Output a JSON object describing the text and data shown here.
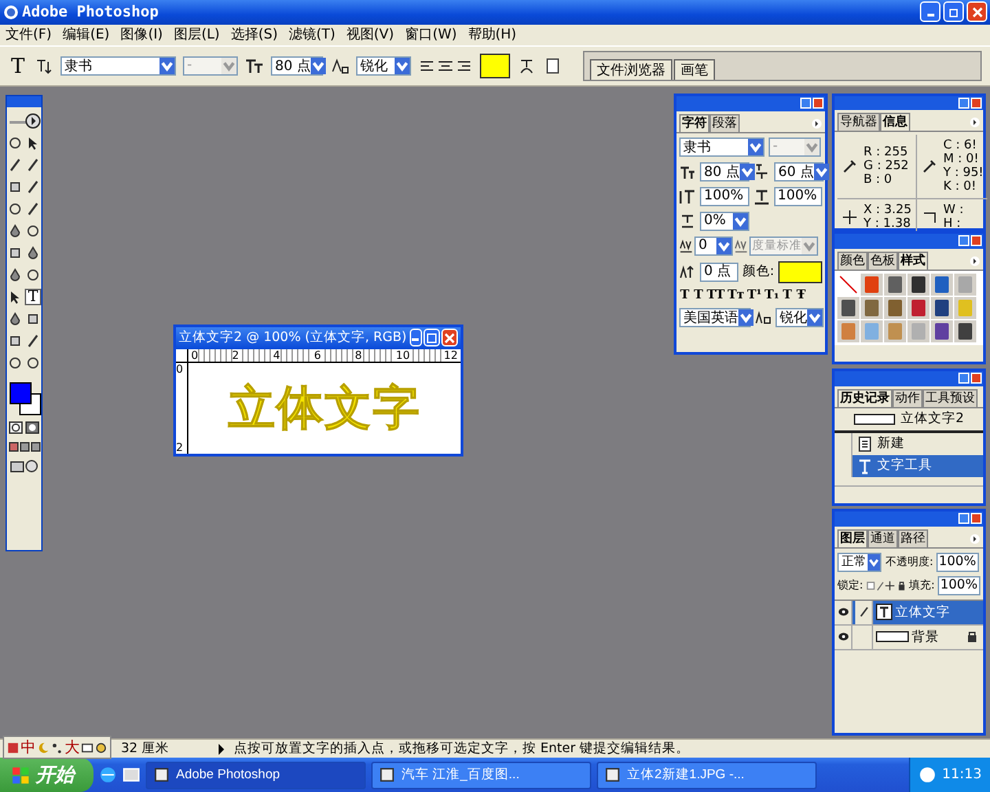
{
  "window": {
    "title": "Adobe Photoshop"
  },
  "menu": [
    "文件(F)",
    "编辑(E)",
    "图像(I)",
    "图层(L)",
    "选择(S)",
    "滤镜(T)",
    "视图(V)",
    "窗口(W)",
    "帮助(H)"
  ],
  "options_bar": {
    "tool_glyph": "T",
    "font_family": "隶书",
    "font_style": "-",
    "font_size": "80 点",
    "anti_alias": "锐化",
    "well_tabs": [
      "文件浏览器",
      "画笔"
    ]
  },
  "toolbox": {
    "tools": [
      {
        "kind": "marquee",
        "selected": false
      },
      {
        "kind": "move",
        "selected": false
      },
      {
        "kind": "lasso",
        "selected": false
      },
      {
        "kind": "wand",
        "selected": false
      },
      {
        "kind": "crop",
        "selected": false
      },
      {
        "kind": "slice",
        "selected": false
      },
      {
        "kind": "heal",
        "selected": false
      },
      {
        "kind": "brush",
        "selected": false
      },
      {
        "kind": "stamp",
        "selected": false
      },
      {
        "kind": "history",
        "selected": false
      },
      {
        "kind": "eraser",
        "selected": false
      },
      {
        "kind": "bucket",
        "selected": false
      },
      {
        "kind": "blur",
        "selected": false
      },
      {
        "kind": "dodge",
        "selected": false
      },
      {
        "kind": "select",
        "selected": false
      },
      {
        "kind": "type",
        "glyph": "T",
        "selected": true
      },
      {
        "kind": "pen",
        "selected": false
      },
      {
        "kind": "shape",
        "selected": false
      },
      {
        "kind": "notes",
        "selected": false
      },
      {
        "kind": "eyedropper",
        "selected": false
      },
      {
        "kind": "hand",
        "selected": false
      },
      {
        "kind": "zoom",
        "selected": false
      }
    ]
  },
  "document": {
    "title": "立体文字2 @ 100% (立体文字, RGB)",
    "ruler_h": [
      "0",
      "2",
      "4",
      "6",
      "8",
      "10",
      "12"
    ],
    "ruler_v": [
      "0",
      "2"
    ],
    "canvas_text": "立体文字"
  },
  "character": {
    "tabs": [
      {
        "label": "字符",
        "selected": true
      },
      {
        "label": "段落",
        "selected": false
      }
    ],
    "font": "隶书",
    "style": "-",
    "size": "80 点",
    "leading": "60 点",
    "vscale": "100%",
    "hscale": "100%",
    "tsume": "0%",
    "kerning": "0",
    "tracking": "度量标准",
    "baseline": "0 点",
    "color_label": "颜色:",
    "color": "#ffff00",
    "style_buttons": [
      "T",
      "T",
      "TT",
      "Tт",
      "T¹",
      "T₁",
      "T",
      "Ŧ"
    ],
    "language": "美国英语",
    "anti_alias": "锐化"
  },
  "info": {
    "tabs": [
      {
        "label": "导航器",
        "selected": false
      },
      {
        "label": "信息",
        "selected": true
      }
    ],
    "rgb": [
      {
        "label": "R :",
        "value": "255"
      },
      {
        "label": "G :",
        "value": "252"
      },
      {
        "label": "B :",
        "value": "0"
      }
    ],
    "cmyk": [
      {
        "label": "C :",
        "value": "6!"
      },
      {
        "label": "M :",
        "value": "0!"
      },
      {
        "label": "Y :",
        "value": "95!"
      },
      {
        "label": "K :",
        "value": "0!"
      }
    ],
    "xy": [
      {
        "label": "X :",
        "value": "3.25"
      },
      {
        "label": "Y :",
        "value": "1.38"
      }
    ],
    "wh": [
      {
        "label": "W :"
      },
      {
        "label": "H :"
      }
    ]
  },
  "styles": {
    "tabs": [
      {
        "label": "颜色",
        "selected": false
      },
      {
        "label": "色板",
        "selected": false
      },
      {
        "label": "样式",
        "selected": true
      }
    ],
    "swatches": [
      {
        "kind": "none"
      },
      {
        "kind": "style",
        "color": "#e04010"
      },
      {
        "kind": "style",
        "color": "#606060"
      },
      {
        "kind": "style",
        "color": "#303030"
      },
      {
        "kind": "style",
        "color": "#2060c0"
      },
      {
        "kind": "style",
        "color": "#a8a8a8"
      },
      {
        "kind": "style",
        "color": "#505050"
      },
      {
        "kind": "style",
        "color": "#806840"
      },
      {
        "kind": "style",
        "color": "#806030"
      },
      {
        "kind": "style",
        "color": "#c02030"
      },
      {
        "kind": "style",
        "color": "#204080"
      },
      {
        "kind": "style",
        "color": "#e0c020"
      },
      {
        "kind": "style",
        "color": "#d08040"
      },
      {
        "kind": "style",
        "color": "#80b0e0"
      },
      {
        "kind": "style",
        "color": "#c09050"
      },
      {
        "kind": "style",
        "color": "#b0b0b0"
      },
      {
        "kind": "style",
        "color": "#6040a0"
      },
      {
        "kind": "style",
        "color": "#404040"
      }
    ]
  },
  "history": {
    "tabs": [
      {
        "label": "历史记录",
        "selected": true
      },
      {
        "label": "动作",
        "selected": false
      },
      {
        "label": "工具预设",
        "selected": false
      }
    ],
    "snapshot": "立体文字2",
    "states": [
      {
        "label": "新建",
        "kind": "new",
        "selected": false
      },
      {
        "label": "文字工具",
        "kind": "type",
        "selected": true
      }
    ]
  },
  "layers": {
    "tabs": [
      {
        "label": "图层",
        "selected": true
      },
      {
        "label": "通道",
        "selected": false
      },
      {
        "label": "路径",
        "selected": false
      }
    ],
    "blend": "正常",
    "opacity_label": "不透明度:",
    "opacity": "100%",
    "lock_label": "锁定:",
    "fill_label": "填充:",
    "fill": "100%",
    "items": [
      {
        "name": "立体文字",
        "kind": "text",
        "selected": true,
        "visible": true,
        "locked": false
      },
      {
        "name": "背景",
        "kind": "image",
        "selected": false,
        "visible": true,
        "locked": true
      }
    ]
  },
  "ime": {
    "mode": "中",
    "width": "大"
  },
  "status_bar": {
    "size": "32 厘米",
    "message": "点按可放置文字的插入点，或拖移可选定文字，按 Enter 键提交编辑结果。"
  },
  "taskbar": {
    "start": "开始",
    "tasks": [
      {
        "label": "Adobe Photoshop",
        "selected": true
      },
      {
        "label": "汽车 江淮_百度图...",
        "selected": false
      },
      {
        "label": "立体2新建1.JPG -...",
        "selected": false
      }
    ],
    "clock": "11:13"
  }
}
